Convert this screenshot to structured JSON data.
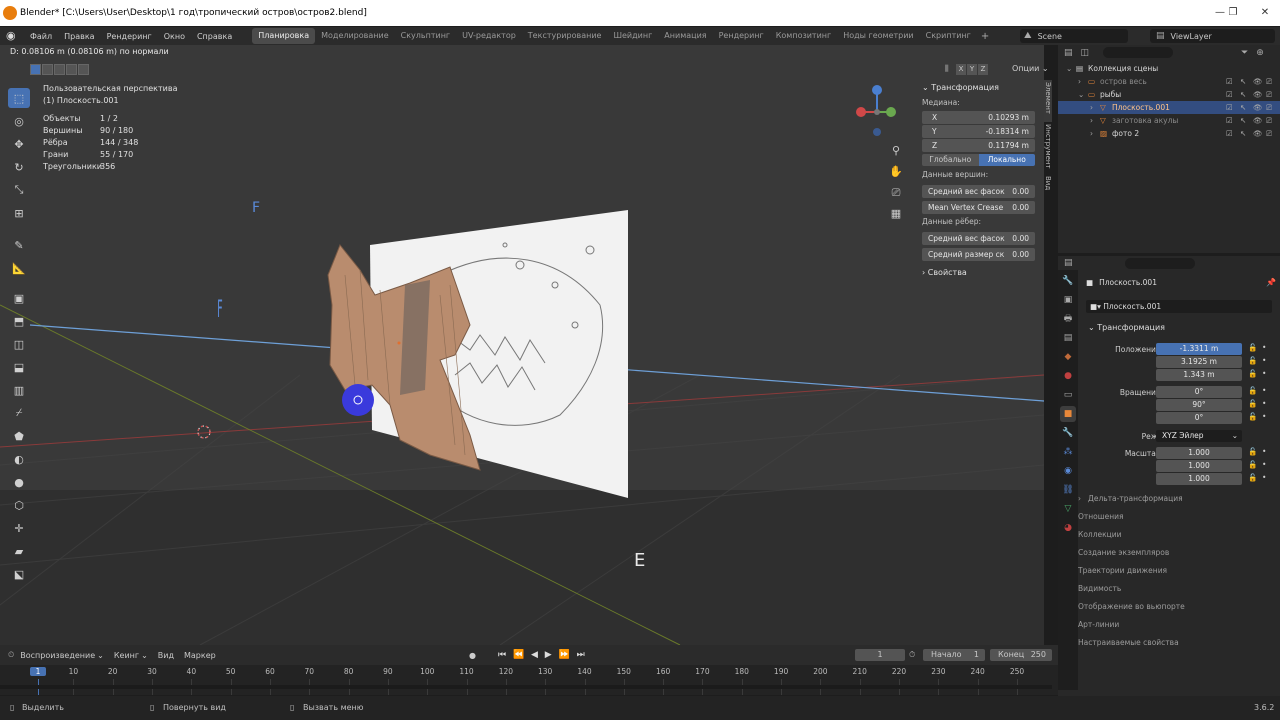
{
  "window": {
    "title": "Blender* [C:\\Users\\User\\Desktop\\1 год\\тропический остров\\остров2.blend]",
    "controls": [
      "—",
      "❐",
      "✕"
    ]
  },
  "menus": [
    "Файл",
    "Правка",
    "Рендеринг",
    "Окно",
    "Справка"
  ],
  "workspaces": [
    {
      "label": "Планировка",
      "active": true
    },
    {
      "label": "Моделирование",
      "active": false
    },
    {
      "label": "Скульптинг",
      "active": false
    },
    {
      "label": "UV-редактор",
      "active": false
    },
    {
      "label": "Текстурирование",
      "active": false
    },
    {
      "label": "Шейдинг",
      "active": false
    },
    {
      "label": "Анимация",
      "active": false
    },
    {
      "label": "Рендеринг",
      "active": false
    },
    {
      "label": "Композитинг",
      "active": false
    },
    {
      "label": "Ноды геометрии",
      "active": false
    },
    {
      "label": "Скриптинг",
      "active": false
    }
  ],
  "scene_name": "Scene",
  "view_layer": "ViewLayer",
  "viewport": {
    "header_info": "D: 0.08106 m (0.08106 m) по нормали",
    "axis_buttons": [
      "X",
      "Y",
      "Z"
    ],
    "options_label": "Опции",
    "view_title": "Пользовательская перспектива",
    "active_name": "(1) Плоскость.001",
    "stats": [
      {
        "label": "Объекты",
        "value": "1 / 2"
      },
      {
        "label": "Вершины",
        "value": "90 / 180"
      },
      {
        "label": "Рёбра",
        "value": "144 / 348"
      },
      {
        "label": "Грани",
        "value": "55 / 170"
      },
      {
        "label": "Треугольники",
        "value": "356"
      }
    ],
    "floating_letters": {
      "f1": "F",
      "f2": "F",
      "e": "E"
    },
    "gizmo": {
      "x": "X",
      "y": "Y",
      "z": "Z"
    }
  },
  "npanel": {
    "section": "Трансформация",
    "median_label": "Медиана:",
    "fields": [
      {
        "axis": "X",
        "value": "0.10293 m"
      },
      {
        "axis": "Y",
        "value": "-0.18314 m"
      },
      {
        "axis": "Z",
        "value": "0.11794 m"
      }
    ],
    "global_label": "Глобально",
    "local_label": "Локально",
    "vertex_data_label": "Данные вершин:",
    "vertex_fields": [
      {
        "label": "Средний вес фасок",
        "value": "0.00"
      },
      {
        "label": "Mean Vertex Crease",
        "value": "0.00"
      }
    ],
    "edge_data_label": "Данные рёбер:",
    "edge_fields": [
      {
        "label": "Средний вес фасок",
        "value": "0.00"
      },
      {
        "label": "Средний размер ск",
        "value": "0.00"
      }
    ],
    "properties_label": "Свойства",
    "side_tabs": [
      "Элемент",
      "Инструмент",
      "Вид"
    ]
  },
  "outliner": {
    "rows": [
      {
        "label": "Коллекция сцены",
        "indent": 0,
        "selected": false,
        "dim": false
      },
      {
        "label": "остров весь",
        "indent": 1,
        "selected": false,
        "dim": true
      },
      {
        "label": "рыбы",
        "indent": 1,
        "selected": false,
        "dim": false
      },
      {
        "label": "Плоскость.001",
        "indent": 2,
        "selected": true,
        "dim": false
      },
      {
        "label": "заготовка акулы",
        "indent": 2,
        "selected": false,
        "dim": true
      },
      {
        "label": "фото 2",
        "indent": 2,
        "selected": false,
        "dim": false
      }
    ]
  },
  "properties": {
    "object_name": "Плоскость.001",
    "data_name": "Плоскость.001",
    "transform_label": "Трансформация",
    "location": [
      {
        "label": "Положение X",
        "value": "-1.3311 m",
        "blue": true
      },
      {
        "label": "Y",
        "value": "3.1925 m",
        "blue": false
      },
      {
        "label": "Z",
        "value": "1.343 m",
        "blue": false
      }
    ],
    "rotation": [
      {
        "label": "Вращение X",
        "value": "0°"
      },
      {
        "label": "Y",
        "value": "90°"
      },
      {
        "label": "Z",
        "value": "0°"
      }
    ],
    "mode_label": "Режим",
    "mode_value": "XYZ Эйлер",
    "scale": [
      {
        "label": "Масштаб X",
        "value": "1.000"
      },
      {
        "label": "Y",
        "value": "1.000"
      },
      {
        "label": "Z",
        "value": "1.000"
      }
    ],
    "sections": [
      "Дельта-трансформация",
      "Отношения",
      "Коллекции",
      "Создание экземпляров",
      "Траектории движения",
      "Видимость",
      "Отображение во вьюпорте",
      "Арт-линии",
      "Настраиваемые свойства"
    ]
  },
  "timeline": {
    "menus": [
      "Воспроизведение",
      "Кеинг",
      "Вид",
      "Маркер"
    ],
    "current_frame": "1",
    "start_label": "Начало",
    "start_value": "1",
    "end_label": "Конец",
    "end_value": "250",
    "ticks": [
      "1",
      "10",
      "20",
      "30",
      "40",
      "50",
      "60",
      "70",
      "80",
      "90",
      "100",
      "110",
      "120",
      "130",
      "140",
      "150",
      "160",
      "170",
      "180",
      "190",
      "200",
      "210",
      "220",
      "230",
      "240",
      "250"
    ]
  },
  "status": {
    "select": "Выделить",
    "rotate": "Повернуть вид",
    "menu": "Вызвать меню",
    "version": "3.6.2"
  },
  "colors": {
    "accent": "#4772b3",
    "selected_row": "#334d80",
    "viewport_bg": "#393939",
    "panel_bg": "#282828"
  }
}
